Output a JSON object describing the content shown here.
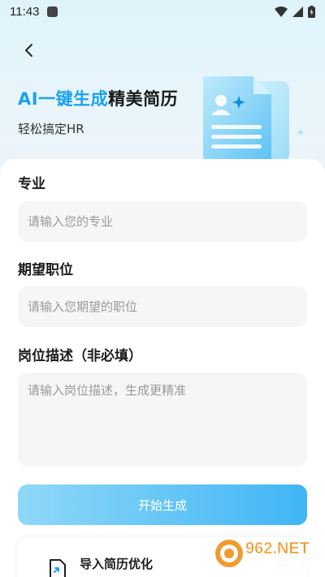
{
  "status_bar": {
    "time": "11:43"
  },
  "hero": {
    "title_accent": "AI一键生成",
    "title_rest": "精美简历",
    "subtitle": "轻松搞定HR"
  },
  "form": {
    "major": {
      "label": "专业",
      "placeholder": "请输入您的专业",
      "value": ""
    },
    "position": {
      "label": "期望职位",
      "placeholder": "请输入您期望的职位",
      "value": ""
    },
    "description": {
      "label": "岗位描述（非必填）",
      "placeholder": "请输入岗位描述，生成更精准",
      "value": ""
    }
  },
  "actions": {
    "generate_label": "开始生成",
    "import_label": "导入简历优化"
  },
  "watermark": {
    "line1": "962.NET",
    "line2": "乐游网"
  },
  "colors": {
    "accent": "#1aa3f0",
    "button_start": "#8fd8f7",
    "button_end": "#40b5f5"
  }
}
